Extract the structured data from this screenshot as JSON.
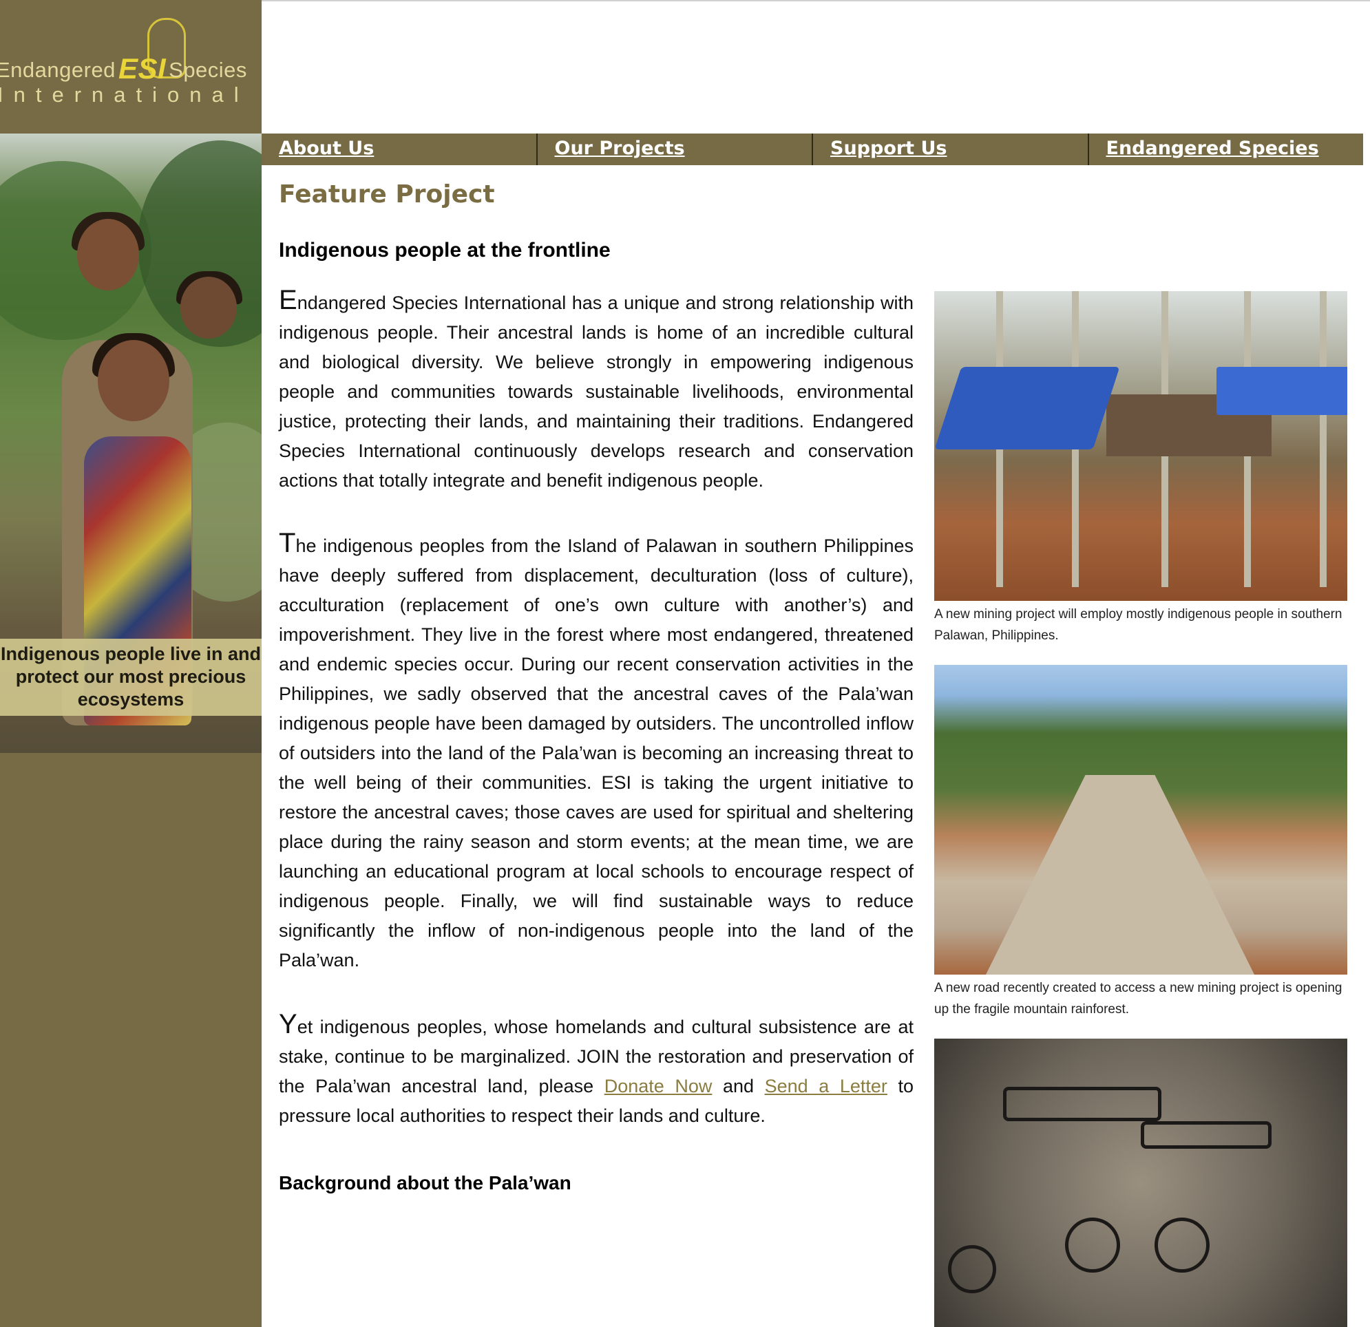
{
  "logo": {
    "word_left": "Endangered",
    "mark": "ESI",
    "word_right": "Species",
    "line2": "International",
    "icon": "gorilla-icon"
  },
  "sidebar": {
    "photo_caption": "Indigenous people live in and protect our most precious ecosystems"
  },
  "nav": {
    "items": [
      "About Us",
      "Our Projects",
      "Support Us",
      "Endangered Species"
    ]
  },
  "main": {
    "section_title": "Feature Project",
    "article_title": "Indigenous people at the frontline",
    "p1": {
      "initial": "E",
      "text": "ndangered Species International has a unique and strong relationship with indigenous people. Their ancestral lands is home of an incredible cultural and biological diversity. We believe strongly in empowering indigenous people and communities towards sustainable livelihoods, environmental justice, protecting their lands, and maintaining their traditions. Endangered Species International continuously develops research and conservation actions that totally integrate and benefit indigenous people."
    },
    "p2": {
      "initial": "T",
      "text": "he indigenous peoples from the Island of Palawan in southern Philippines have deeply suffered from displacement, deculturation (loss of culture), acculturation (replacement of one’s own culture with another’s) and impoverishment. They live in the forest where most endangered, threatened and endemic species occur. During our recent conservation activities in the Philippines, we sadly observed that the ancestral caves of the Pala’wan indigenous people have been damaged by outsiders. The uncontrolled inflow of outsiders into the land of the Pala’wan is becoming an increasing threat to the well being of their communities. ESI is taking the urgent initiative to restore the ancestral caves; those caves are used for spiritual and sheltering place during the rainy season and storm events; at the mean time, we are launching an educational program at local schools to encourage respect of indigenous people. Finally, we will find sustainable ways to reduce significantly the inflow of non-indigenous people into the land of the Pala’wan."
    },
    "p3": {
      "initial": "Y",
      "text_a": "et indigenous peoples, whose homelands and cultural subsistence are at stake, continue to be marginalized. JOIN the restoration and preservation of the Pala’wan ancestral land, please ",
      "link1": "Donate Now",
      "text_b": " and ",
      "link2": "Send a Letter",
      "text_c": " to pressure local authorities to respect their lands and culture."
    },
    "background_title": "Background about the Pala’wan"
  },
  "figures": [
    {
      "caption": "A new mining project will employ mostly indigenous people in southern Palawan, Philippines."
    },
    {
      "caption": "A new road recently created to access a new mining project is opening up the fragile mountain rainforest."
    },
    {
      "caption": ""
    }
  ]
}
